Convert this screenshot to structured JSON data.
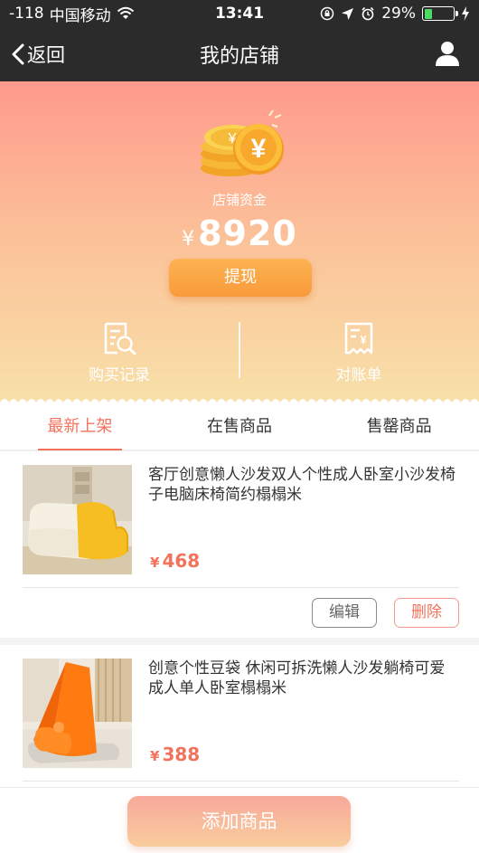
{
  "status_bar": {
    "signal": "-118",
    "carrier": "中国移动",
    "time": "13:41",
    "battery_percent": "29%",
    "battery_level": 0.29
  },
  "nav": {
    "back_label": "返回",
    "title": "我的店铺",
    "user_icon": "user-icon"
  },
  "funds": {
    "label": "店铺资金",
    "currency": "¥",
    "amount": "8920",
    "withdraw_label": "提现"
  },
  "entries": {
    "purchase_records": "购买记录",
    "statement": "对账单"
  },
  "tabs": [
    {
      "label": "最新上架",
      "active": true
    },
    {
      "label": "在售商品",
      "active": false
    },
    {
      "label": "售罄商品",
      "active": false
    }
  ],
  "products": [
    {
      "name": "客厅创意懒人沙发双人个性成人卧室小沙发椅子电脑床椅简约榻榻米",
      "currency": "¥",
      "price": "468",
      "edit_label": "编辑",
      "delete_label": "删除"
    },
    {
      "name": "创意个性豆袋 休闲可拆洗懒人沙发躺椅可爱成人单人卧室榻榻米",
      "currency": "¥",
      "price": "388"
    }
  ],
  "bottom": {
    "add_label": "添加商品"
  },
  "colors": {
    "accent": "#f2725c",
    "nav_bg": "#2b2b2b",
    "header_top": "#ff9a8c",
    "header_bottom": "#f8e1a9",
    "withdraw": "#f99a3b"
  }
}
